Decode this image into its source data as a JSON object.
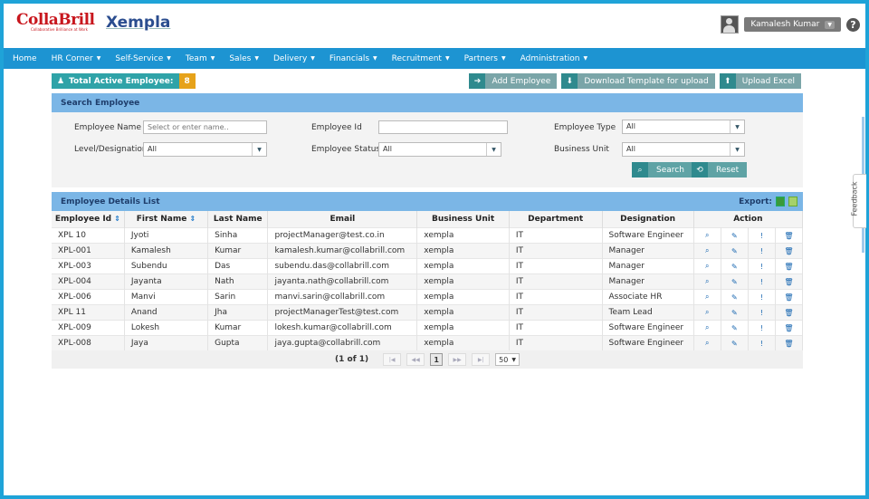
{
  "brand": {
    "logo_text": "CollaBrill",
    "logo_tagline": "Collaborative Brilliance at Work",
    "product": "Xempla"
  },
  "user": {
    "name": "Kamalesh Kumar"
  },
  "nav": [
    "Home",
    "HR Corner",
    "Self-Service",
    "Team",
    "Sales",
    "Delivery",
    "Financials",
    "Recruitment",
    "Partners",
    "Administration"
  ],
  "stats": {
    "total_active_label": "Total Active Employee:",
    "total_active_count": "8"
  },
  "actions": {
    "add_employee": "Add Employee",
    "download_template": "Download Template for upload",
    "upload_excel": "Upload Excel"
  },
  "search": {
    "title": "Search Employee",
    "employee_name_label": "Employee Name",
    "employee_name_placeholder": "Select or enter name..",
    "employee_id_label": "Employee Id",
    "employee_type_label": "Employee Type",
    "employee_type_value": "All",
    "level_label": "Level/Designation",
    "level_value": "All",
    "status_label": "Employee Status",
    "status_value": "All",
    "bu_label": "Business Unit",
    "bu_value": "All",
    "search_btn": "Search",
    "reset_btn": "Reset"
  },
  "list": {
    "title": "Employee Details List",
    "export_label": "Export:",
    "columns": [
      "Employee Id",
      "First Name",
      "Last Name",
      "Email",
      "Business Unit",
      "Department",
      "Designation",
      "Action"
    ],
    "rows": [
      [
        "XPL 10",
        "Jyoti",
        "Sinha",
        "projectManager@test.co.in",
        "xempla",
        "IT",
        "Software Engineer"
      ],
      [
        "XPL-001",
        "Kamalesh",
        "Kumar",
        "kamalesh.kumar@collabrill.com",
        "xempla",
        "IT",
        "Manager"
      ],
      [
        "XPL-003",
        "Subendu",
        "Das",
        "subendu.das@collabrill.com",
        "xempla",
        "IT",
        "Manager"
      ],
      [
        "XPL-004",
        "Jayanta",
        "Nath",
        "jayanta.nath@collabrill.com",
        "xempla",
        "IT",
        "Manager"
      ],
      [
        "XPL-006",
        "Manvi",
        "Sarin",
        "manvi.sarin@collabrill.com",
        "xempla",
        "IT",
        "Associate HR"
      ],
      [
        "XPL 11",
        "Anand",
        "Jha",
        "projectManagerTest@test.com",
        "xempla",
        "IT",
        "Team Lead"
      ],
      [
        "XPL-009",
        "Lokesh",
        "Kumar",
        "lokesh.kumar@collabrill.com",
        "xempla",
        "IT",
        "Software Engineer"
      ],
      [
        "XPL-008",
        "Jaya",
        "Gupta",
        "jaya.gupta@collabrill.com",
        "xempla",
        "IT",
        "Software Engineer"
      ]
    ]
  },
  "pagination": {
    "summary": "(1 of 1)",
    "current": "1",
    "page_size": "50"
  },
  "feedback": "Feedback"
}
